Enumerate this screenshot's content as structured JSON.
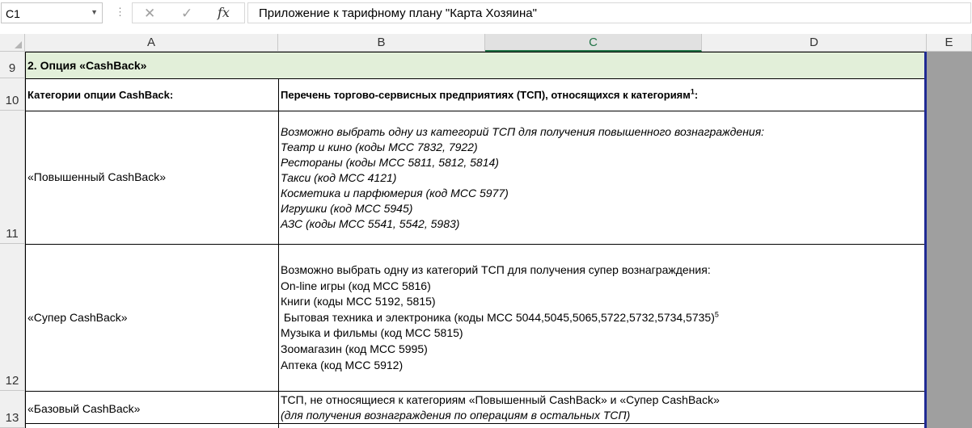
{
  "formula_bar": {
    "name_box": "C1",
    "dots": "⋮",
    "cancel_icon": "✕",
    "enter_icon": "✓",
    "fx_label": "fx",
    "content": "Приложение к тарифному плану \"Карта Хозяина\""
  },
  "columns": [
    "A",
    "B",
    "C",
    "D",
    "E"
  ],
  "selected_column": "C",
  "rows": [
    "9",
    "10",
    "11",
    "12",
    "13"
  ],
  "cells": {
    "r9": {
      "title": "2. Опция «CashBack»"
    },
    "r10": {
      "a": "Категории опции CashBack:",
      "b": "Перечень торгово-сервисных предприятиях (ТСП), относящихся к категориям",
      "b_sup": "1",
      "b_tail": ":"
    },
    "r11": {
      "a": "«Повышенный CashBack»",
      "b_lines": [
        "Возможно выбрать одну из категорий ТСП для получения повышенного вознаграждения:",
        "Театр и кино (коды МСС 7832, 7922)",
        "Рестораны (коды МСС 5811, 5812, 5814)",
        "Такси (код МСС 4121)",
        "Косметика и парфюмерия (код МСС 5977)",
        "Игрушки (код МСС 5945)",
        "АЗС (коды МСС 5541, 5542, 5983)"
      ]
    },
    "r12": {
      "a": "«Супер CashBack»",
      "b_lines": [
        "Возможно выбрать одну из категорий ТСП для получения супер вознаграждения:",
        "On-line игры (код МСС 5816)",
        "Книги (коды МСС 5192, 5815)",
        " Бытовая техника и электроника (коды МСС 5044,5045,5065,5722,5732,5734,5735)",
        "Музыка и фильмы (код МСС 5815)",
        "Зоомагазин (код МСС 5995)",
        "Аптека (код МСС 5912)"
      ],
      "b_sup_line4": "5"
    },
    "r13": {
      "a": "«Базовый CashBack»",
      "b_line1": "ТСП, не относящиеся к категориям «Повышенный CashBack» и «Супер CashBack»",
      "b_line2": "(для получения вознаграждения по операциям в остальных ТСП)"
    }
  },
  "colors": {
    "header_fill": "#e2efd9",
    "selected_col_accent": "#217346",
    "print_boundary": "#1f2a93",
    "outside_area": "#9f9f9f"
  }
}
